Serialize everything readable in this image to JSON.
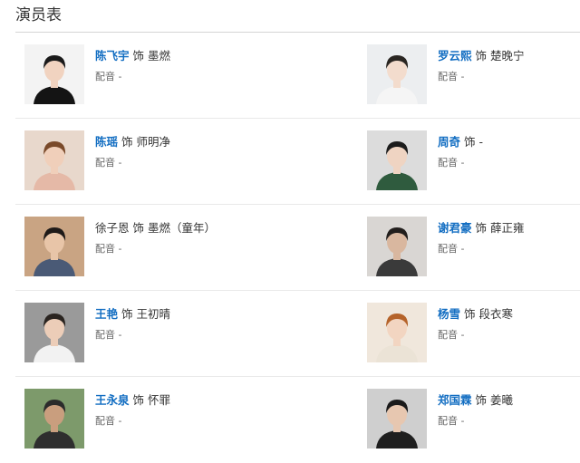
{
  "section_title": "演员表",
  "role_word": "饰",
  "voice_label": "配音",
  "cast": [
    {
      "left": {
        "actor": "陈飞宇",
        "role": "墨燃",
        "linked": true,
        "voice": "-",
        "photo": {
          "bg": "#f3f3f3",
          "hair": "#1a1a1a",
          "skin": "#f1d3c0",
          "cloth": "#141414"
        }
      },
      "right": {
        "actor": "罗云熙",
        "role": "楚晚宁",
        "linked": true,
        "voice": "-",
        "photo": {
          "bg": "#eceef0",
          "hair": "#2a2622",
          "skin": "#f3dccd",
          "cloth": "#f5f5f5"
        }
      }
    },
    {
      "left": {
        "actor": "陈瑶",
        "role": "师明净",
        "linked": true,
        "voice": "-",
        "photo": {
          "bg": "#e8d8cc",
          "hair": "#7a4a2a",
          "skin": "#f0cfba",
          "cloth": "#e5b9a7"
        }
      },
      "right": {
        "actor": "周奇",
        "role": "-",
        "linked": true,
        "voice": "-",
        "photo": {
          "bg": "#dcdcdc",
          "hair": "#1c1c1c",
          "skin": "#efd4c2",
          "cloth": "#2f5b3e"
        }
      }
    },
    {
      "left": {
        "actor": "徐子恩",
        "role": "墨燃（童年）",
        "linked": false,
        "voice": "-",
        "photo": {
          "bg": "#c9a483",
          "hair": "#1e1a18",
          "skin": "#e8c5a8",
          "cloth": "#4a5a76"
        }
      },
      "right": {
        "actor": "谢君豪",
        "role": "薛正雍",
        "linked": true,
        "voice": "-",
        "photo": {
          "bg": "#d9d6d3",
          "hair": "#221e1c",
          "skin": "#d9b79f",
          "cloth": "#3a3a3a"
        }
      }
    },
    {
      "left": {
        "actor": "王艳",
        "role": "王初晴",
        "linked": true,
        "voice": "-",
        "photo": {
          "bg": "#9a9a9a",
          "hair": "#2a2420",
          "skin": "#eccdb8",
          "cloth": "#f2f2f2"
        }
      },
      "right": {
        "actor": "杨雪",
        "role": "段衣寒",
        "linked": true,
        "voice": "-",
        "photo": {
          "bg": "#f0e7dc",
          "hair": "#b5632a",
          "skin": "#f2d5c1",
          "cloth": "#ebe3d6"
        }
      }
    },
    {
      "left": {
        "actor": "王永泉",
        "role": "怀罪",
        "linked": true,
        "voice": "-",
        "photo": {
          "bg": "#7d9a6b",
          "hair": "#2b2b2b",
          "skin": "#c99e7e",
          "cloth": "#2e2e2e"
        }
      },
      "right": {
        "actor": "郑国霖",
        "role": "姜曦",
        "linked": true,
        "voice": "-",
        "photo": {
          "bg": "#cfcfcf",
          "hair": "#1a1a1a",
          "skin": "#e7c7b0",
          "cloth": "#1f1f1f"
        }
      }
    }
  ]
}
